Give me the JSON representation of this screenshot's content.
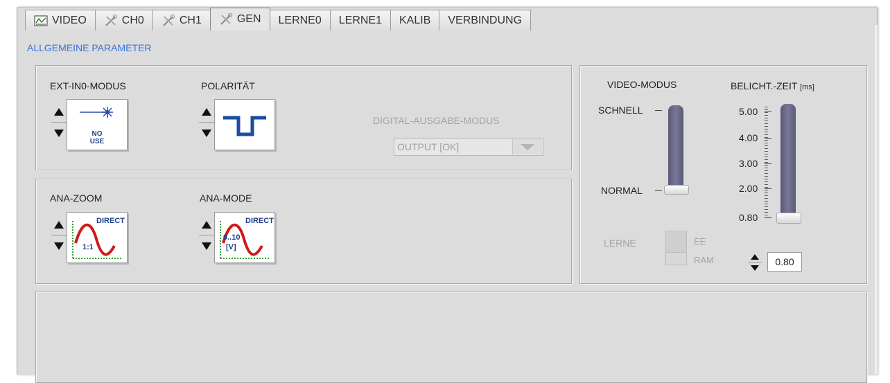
{
  "tabs": [
    {
      "label": "VIDEO",
      "icon": "video-chart-icon"
    },
    {
      "label": "CH0",
      "icon": "tools-icon"
    },
    {
      "label": "CH1",
      "icon": "tools-icon"
    },
    {
      "label": "GEN",
      "icon": "tools-icon",
      "active": true
    },
    {
      "label": "LERNE0"
    },
    {
      "label": "LERNE1"
    },
    {
      "label": "KALIB"
    },
    {
      "label": "VERBINDUNG"
    }
  ],
  "section_title": "ALLGEMEINE PARAMETER",
  "ext_in0": {
    "label": "EXT-IN0-MODUS",
    "icon_text_1": "NO",
    "icon_text_2": "USE"
  },
  "polaritaet": {
    "label": "POLARITÄT"
  },
  "digital_out": {
    "label": "DIGITAL-AUSGABE-MODUS",
    "value": "OUTPUT [OK]"
  },
  "ana_zoom": {
    "label": "ANA-ZOOM",
    "icon_title": "DIRECT",
    "icon_text": "1:1"
  },
  "ana_mode": {
    "label": "ANA-MODE",
    "icon_title": "DIRECT",
    "icon_text_1": "0..10",
    "icon_text_2": "[V]"
  },
  "video_modus": {
    "label": "VIDEO-MODUS",
    "top_label": "SCHNELL",
    "bottom_label": "NORMAL",
    "selected": "NORMAL"
  },
  "belicht": {
    "label": "BELICHT.-ZEIT",
    "unit": "[ms]",
    "ticks": [
      "5.00",
      "4.00",
      "3.00",
      "2.00",
      "0.80"
    ],
    "value": "0.80"
  },
  "lerne": {
    "label": "LERNE",
    "ee": "EE",
    "ram": "RAM"
  },
  "colors": {
    "accent_blue": "#3a72d8",
    "panel_bg": "#dcdcdc",
    "slider_track": "#6a6a88"
  }
}
